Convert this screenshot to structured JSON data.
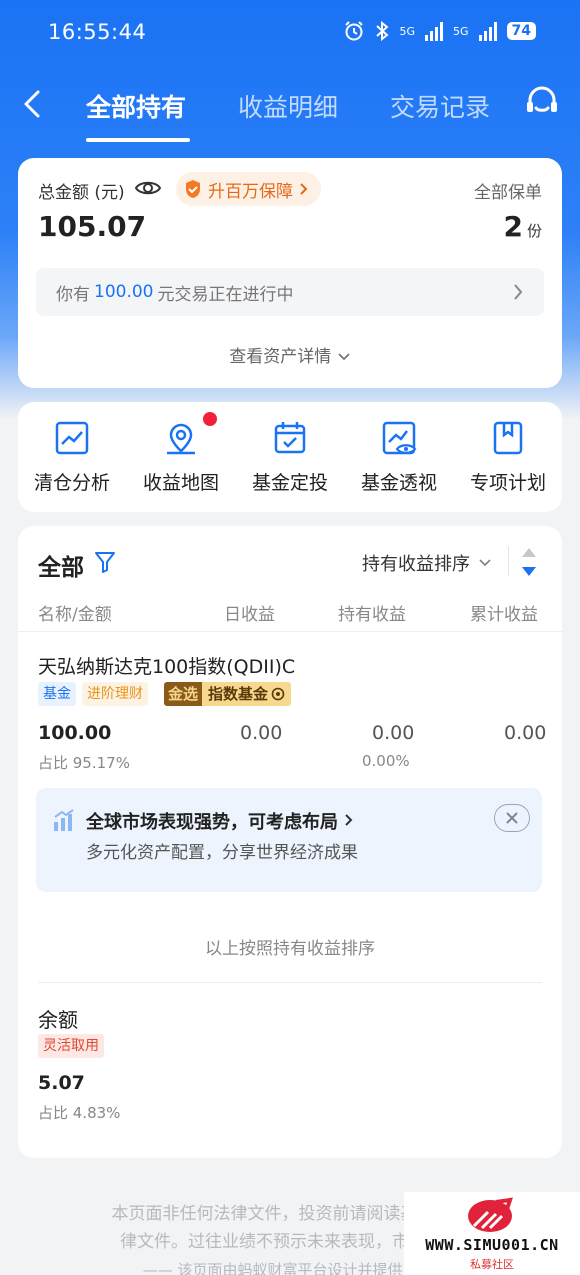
{
  "status": {
    "time": "16:55:44",
    "battery": "74",
    "net1": "5G",
    "net2": "5G"
  },
  "nav": {
    "tabs": [
      {
        "label": "全部持有",
        "active": true
      },
      {
        "label": "收益明细",
        "active": false
      },
      {
        "label": "交易记录",
        "active": false
      }
    ]
  },
  "summary": {
    "total_label": "总金额 (元)",
    "protect_badge": "升百万保障",
    "total_value": "105.07",
    "policy_label": "全部保单",
    "policy_count": "2",
    "policy_unit": "份",
    "progress_prefix": "你有",
    "progress_amount": "100.00",
    "progress_suffix": "元交易正在进行中",
    "detail_link": "查看资产详情"
  },
  "tools": [
    {
      "label": "清仓分析",
      "icon": "chart-line-icon"
    },
    {
      "label": "收益地图",
      "icon": "map-pin-icon"
    },
    {
      "label": "基金定投",
      "icon": "calendar-check-icon"
    },
    {
      "label": "基金透视",
      "icon": "eye-chart-icon"
    },
    {
      "label": "专项计划",
      "icon": "bookmark-doc-icon"
    }
  ],
  "holdings": {
    "title": "全部",
    "sort_label": "持有收益排序",
    "columns": [
      "名称/金额",
      "日收益",
      "持有收益",
      "累计收益"
    ],
    "fund": {
      "name": "天弘纳斯达克100指数(QDII)C",
      "tag1": "基金",
      "tag2": "进阶理财",
      "gold_tag_a": "金选",
      "gold_tag_b": "指数基金",
      "amount": "100.00",
      "ratio": "占比 95.17%",
      "daily": "0.00",
      "holding": "0.00",
      "holding_pct": "0.00%",
      "cumulative": "0.00"
    },
    "promo": {
      "title": "全球市场表现强势，可考虑布局",
      "subtitle": "多元化资产配置，分享世界经济成果"
    },
    "sort_note": "以上按照持有收益排序",
    "balance": {
      "title": "余额",
      "tag": "灵活取用",
      "amount": "5.07",
      "ratio": "占比 4.83%"
    }
  },
  "disclaimer": {
    "line1": "本页面非任何法律文件，投资前请阅读基金合同",
    "line2": "律文件。过往业绩不预示未来表现，市场有风",
    "line3": "——   该页面由蚂蚁财富平台设计并提供   ——"
  },
  "watermark": {
    "url": "WWW.SIMU001.CN",
    "sub": "私募社区"
  },
  "colors": {
    "primary": "#1a73f5",
    "orange": "#e46a1a",
    "red": "#f0223a"
  }
}
